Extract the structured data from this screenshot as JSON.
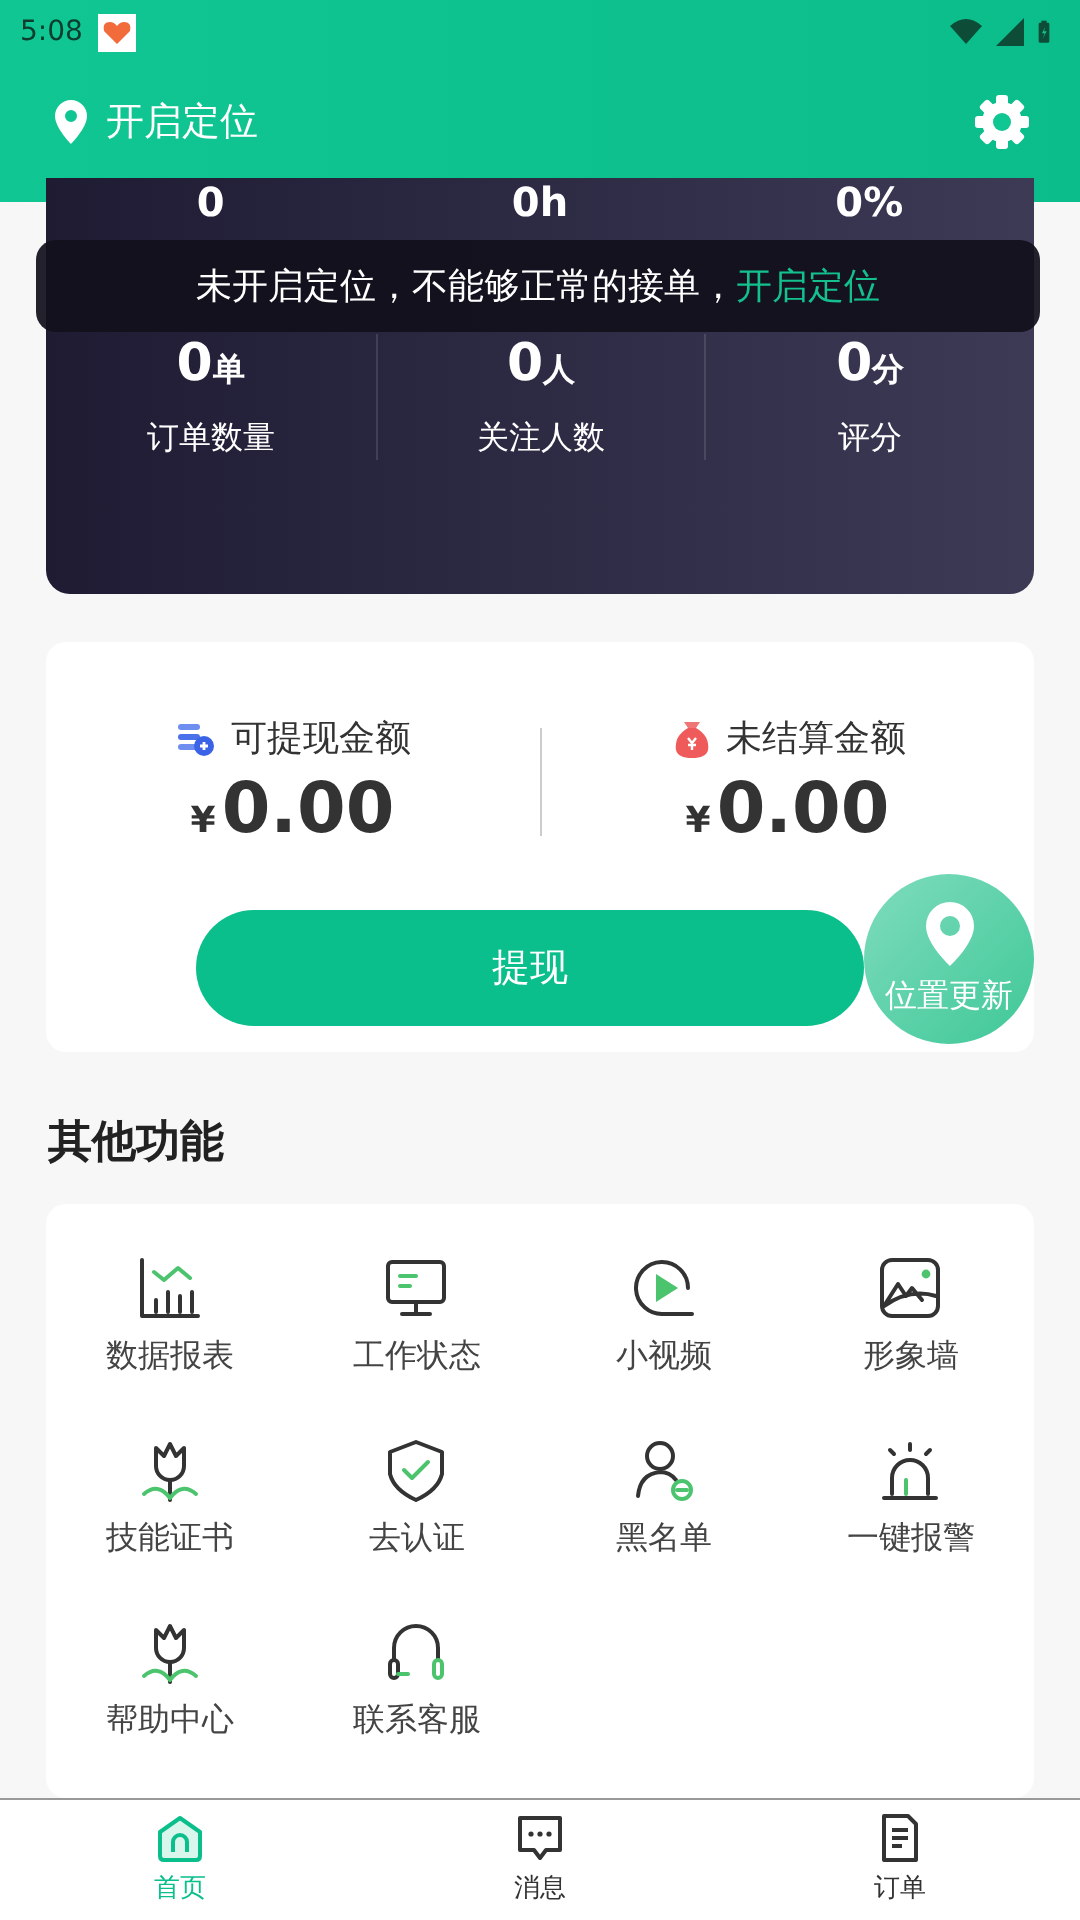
{
  "status_bar": {
    "time": "5:08"
  },
  "header": {
    "location_label": "开启定位"
  },
  "stats_top": [
    {
      "value": "0"
    },
    {
      "value": "0h"
    },
    {
      "value": "0%"
    }
  ],
  "toast": {
    "message": "未开启定位，不能够正常的接单，",
    "action": "开启定位"
  },
  "stats": [
    {
      "value": "0",
      "unit": "单",
      "label": "订单数量"
    },
    {
      "value": "0",
      "unit": "人",
      "label": "关注人数"
    },
    {
      "value": "0",
      "unit": "分",
      "label": "评分"
    }
  ],
  "wallet": {
    "items": [
      {
        "kind": "coins",
        "label": "可提现金额",
        "currency": "¥",
        "amount": "0.00"
      },
      {
        "kind": "bag",
        "label": "未结算金额",
        "currency": "¥",
        "amount": "0.00"
      }
    ],
    "button": "提现"
  },
  "float_button": "位置更新",
  "functions": {
    "title": "其他功能",
    "items": [
      {
        "kind": "chart",
        "label": "数据报表"
      },
      {
        "kind": "monitor",
        "label": "工作状态"
      },
      {
        "kind": "video",
        "label": "小视频"
      },
      {
        "kind": "image",
        "label": "形象墙"
      },
      {
        "kind": "tulip",
        "label": "技能证书"
      },
      {
        "kind": "shield",
        "label": "去认证"
      },
      {
        "kind": "user",
        "label": "黑名单"
      },
      {
        "kind": "alarm",
        "label": "一键报警"
      },
      {
        "kind": "tulip",
        "label": "帮助中心"
      },
      {
        "kind": "headset",
        "label": "联系客服"
      }
    ]
  },
  "bottom_nav": [
    {
      "kind": "home",
      "label": "首页",
      "selected": true
    },
    {
      "kind": "chat",
      "label": "消息",
      "selected": false
    },
    {
      "kind": "doc",
      "label": "订单",
      "selected": false
    }
  ]
}
